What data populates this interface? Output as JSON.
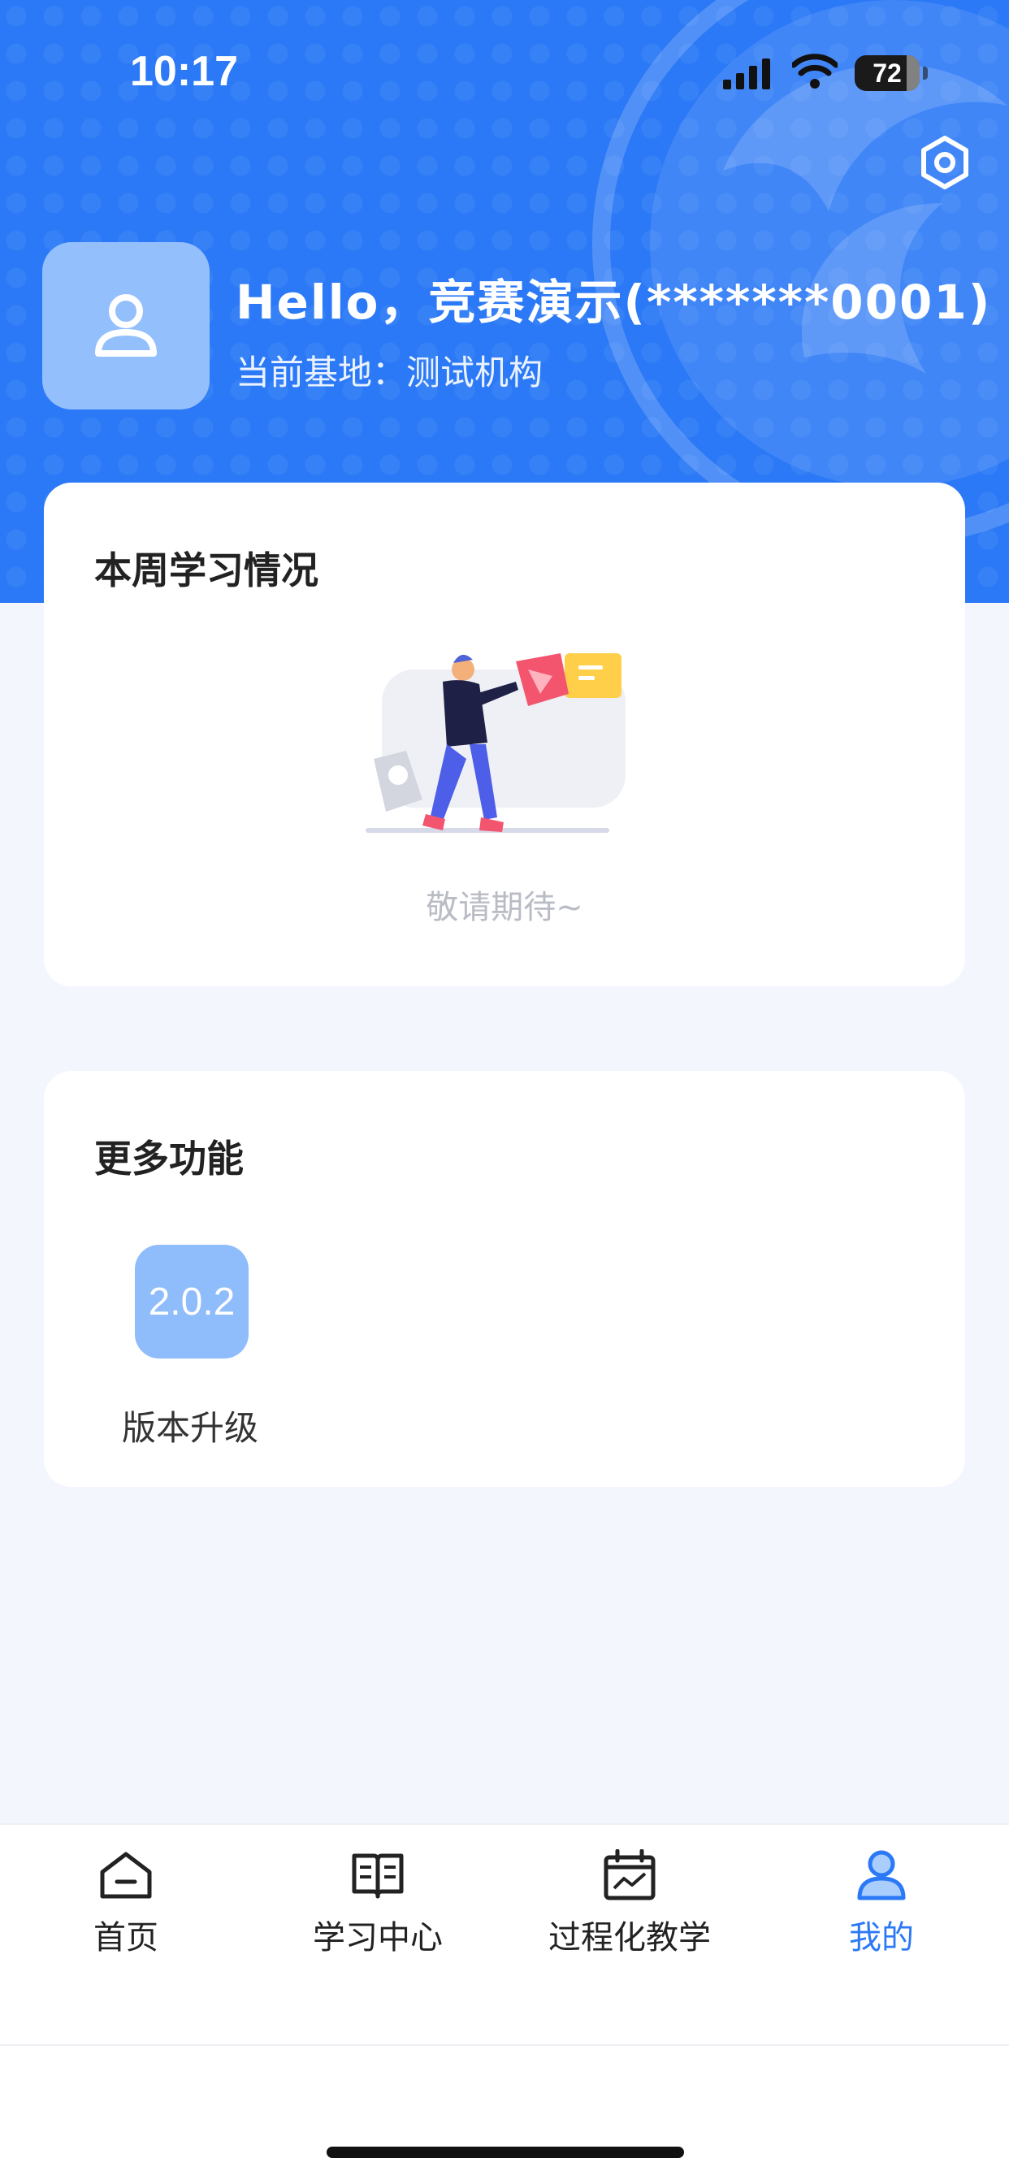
{
  "status_bar": {
    "time": "10:17",
    "battery": "72"
  },
  "header": {
    "greeting": "Hello，竞赛演示(*******0001)",
    "base_label": "当前基地：测试机构",
    "settings_icon": "hexagon-nut-icon",
    "avatar_icon": "user-icon"
  },
  "weekly_card": {
    "title": "本周学习情况",
    "empty_text": "敬请期待~"
  },
  "more_card": {
    "title": "更多功能",
    "items": [
      {
        "icon_text": "2.0.2",
        "label": "版本升级"
      }
    ]
  },
  "tabs": [
    {
      "label": "首页",
      "icon": "home-icon",
      "active": false
    },
    {
      "label": "学习中心",
      "icon": "book-icon",
      "active": false
    },
    {
      "label": "过程化教学",
      "icon": "calendar-chart-icon",
      "active": false
    },
    {
      "label": "我的",
      "icon": "user-icon",
      "active": true
    }
  ],
  "colors": {
    "primary": "#2b79f6",
    "page_bg": "#f4f6fd",
    "avatar_bg": "#93bffc",
    "muted_text": "#b9bcc4"
  }
}
